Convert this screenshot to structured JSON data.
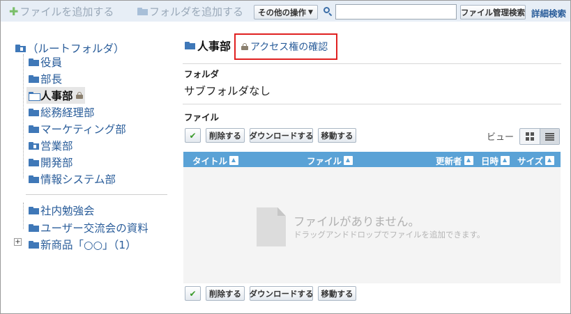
{
  "toolbar": {
    "add_file": "ファイルを追加する",
    "add_folder": "フォルダを追加する",
    "other_ops": "その他の操作",
    "search_value": "",
    "search_button": "ファイル管理検索",
    "detail_search": "詳細検索"
  },
  "tree": {
    "root": "（ルートフォルダ）",
    "items": [
      "役員",
      "部長",
      "人事部",
      "総務経理部",
      "マーケティング部",
      "営業部",
      "開発部",
      "情報システム部"
    ],
    "items2": [
      "社内勉強会",
      "ユーザー交流会の資料",
      "新商品「○○」（1）"
    ]
  },
  "main": {
    "title": "人事部",
    "access_link": "アクセス権の確認",
    "folder_label": "フォルダ",
    "no_subfolder": "サブフォルダなし",
    "file_label": "ファイル",
    "view_label": "ビュー"
  },
  "actions": {
    "delete": "削除する",
    "download": "ダウンロードする",
    "move": "移動する"
  },
  "table": {
    "columns": [
      "タイトル",
      "ファイル",
      "更新者",
      "日時",
      "サイズ"
    ],
    "empty_title": "ファイルがありません。",
    "empty_hint": "ドラッグアンドドロップでファイルを追加できます。"
  },
  "colors": {
    "toolbar_bg": "#e7eef6",
    "link": "#2a5d9a",
    "table_header": "#5aa2d6",
    "highlight_border": "#e02020"
  }
}
